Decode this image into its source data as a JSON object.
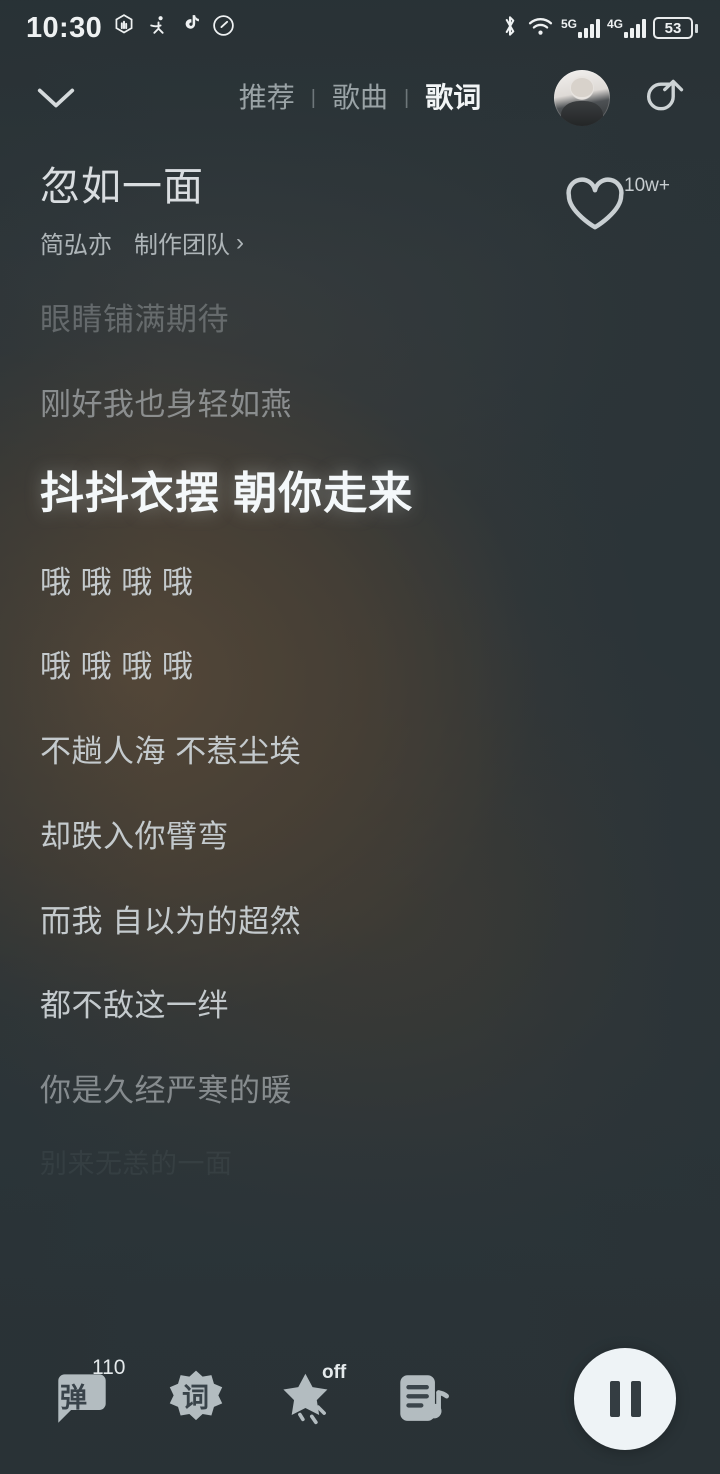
{
  "status_bar": {
    "time": "10:30",
    "left_icons": [
      "dnd-hand-icon",
      "accessibility-icon",
      "tiktok-note-icon",
      "speed-gauge-icon"
    ],
    "bluetooth_icon": "bluetooth-icon",
    "wifi_icon": "wifi-icon",
    "sim1_label": "5G",
    "sim2_label": "4G",
    "battery_percent": "53"
  },
  "top_bar": {
    "collapse_icon": "chevron-down-icon",
    "tabs": [
      {
        "label": "推荐",
        "active": false
      },
      {
        "label": "歌曲",
        "active": false
      },
      {
        "label": "歌词",
        "active": true
      }
    ],
    "separator": "|",
    "avatar": "user-avatar",
    "share_icon": "share-icon"
  },
  "song": {
    "title": "忽如一面",
    "artist": "简弘亦",
    "credits_label": "制作团队",
    "credits_chevron": "›",
    "like_icon": "heart-outline-icon",
    "like_count": "10w+"
  },
  "lyrics": {
    "lines": [
      {
        "text": "眼睛铺满期待",
        "state": "dim"
      },
      {
        "text": "刚好我也身轻如燕",
        "state": "dim2"
      },
      {
        "text": "抖抖衣摆 朝你走来",
        "state": "active"
      },
      {
        "text": "哦 哦 哦 哦",
        "state": "normal"
      },
      {
        "text": "哦 哦 哦 哦",
        "state": "normal"
      },
      {
        "text": "不趟人海 不惹尘埃",
        "state": "normal"
      },
      {
        "text": "却跌入你臂弯",
        "state": "normal"
      },
      {
        "text": "而我 自以为的超然",
        "state": "normal"
      },
      {
        "text": "都不敌这一绊",
        "state": "normal"
      },
      {
        "text": "你是久经严寒的暖",
        "state": "dim2"
      },
      {
        "text": "别来无恙的一面",
        "state": "ghost"
      }
    ]
  },
  "bottom_bar": {
    "danmaku": {
      "icon": "danmaku-bubble-icon",
      "glyph": "弹",
      "badge": "110"
    },
    "lyric_tool": {
      "icon": "lyric-flower-icon",
      "glyph": "词"
    },
    "effects": {
      "icon": "star-sparkle-icon",
      "state_label": "off"
    },
    "playlist": {
      "icon": "playlist-music-icon"
    },
    "play": {
      "icon": "pause-icon",
      "state": "playing"
    }
  },
  "colors": {
    "background_cool": "#2c3539",
    "background_warm": "#564838",
    "active_lyric": "#f4f8fa",
    "lyric": "#c4cacd",
    "accent_button": "#eef3f6"
  }
}
